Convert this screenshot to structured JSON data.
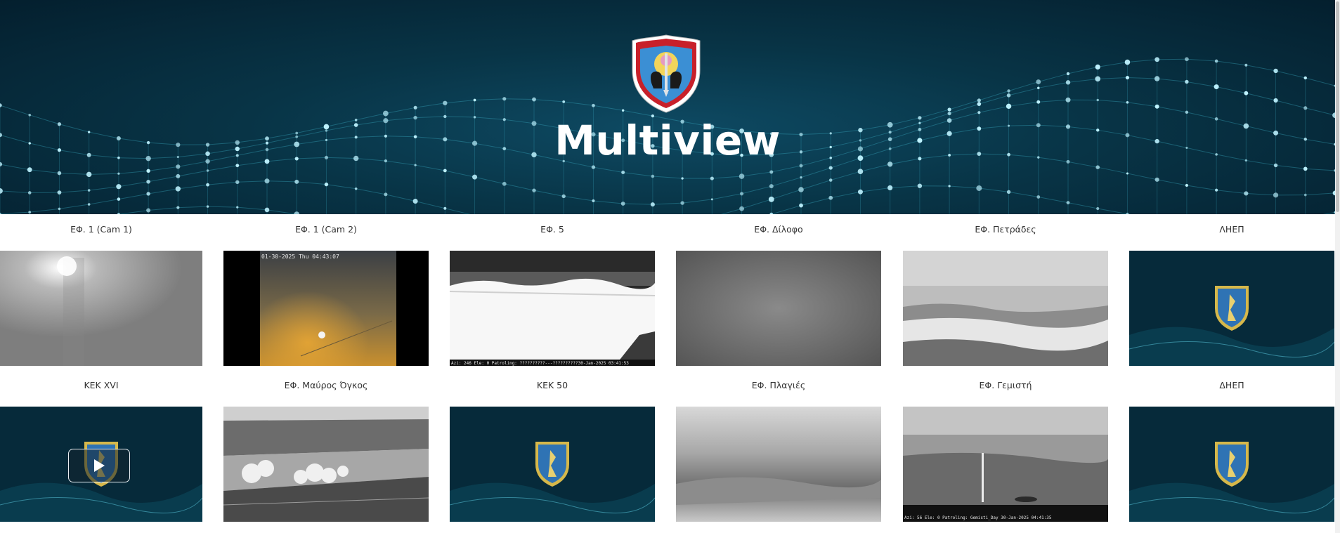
{
  "header": {
    "title": "Multiview",
    "logo": "military-shield-logo"
  },
  "colors": {
    "hero_dark": "#041f2e",
    "hero_mid": "#0e4a63",
    "net_glow": "#5fd0e6",
    "label_text": "#333333"
  },
  "cameras": [
    {
      "label": "ΕΦ. 1 (Cam 1)",
      "feed": "gray-fog-night"
    },
    {
      "label": "ΕΦ. 1 (Cam 2)",
      "feed": "orange-fog-night",
      "overlay": "01-30-2025 Thu 04:43:07"
    },
    {
      "label": "ΕΦ. 5",
      "feed": "thermal-white-field",
      "overlay": "Azi: 246 Ele: 0 Patroling: ??????????---??????????30-Jan-2025 03:41:53"
    },
    {
      "label": "ΕΦ. Δίλοφο",
      "feed": "gray-blank"
    },
    {
      "label": "ΕΦ. Πετράδες",
      "feed": "thermal-hills"
    },
    {
      "label": "ΛΗΕΠ",
      "feed": "offline-emblem"
    },
    {
      "label": "ΚΕΚ XVI",
      "feed": "offline-emblem",
      "play_button": "play-icon"
    },
    {
      "label": "ΕΦ. Μαύρος Όγκος",
      "feed": "thermal-trees"
    },
    {
      "label": "ΚΕΚ 50",
      "feed": "offline-emblem"
    },
    {
      "label": "ΕΦ. Πλαγιές",
      "feed": "thermal-gray-valley"
    },
    {
      "label": "ΕΦ. Γεμιστή",
      "feed": "thermal-mast",
      "overlay": "Azi: 56 Ele: 0 Patroling: Gemisti_Day     30-Jan-2025 04:41:35"
    },
    {
      "label": "ΔΗΕΠ",
      "feed": "offline-emblem"
    }
  ]
}
